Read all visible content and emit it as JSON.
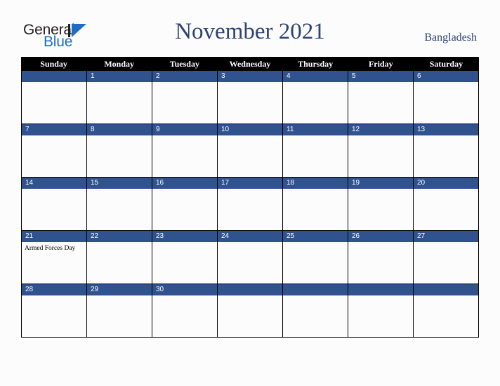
{
  "brand": {
    "name_part1": "General",
    "name_part2": "Blue",
    "mark": "triangle-logo-icon",
    "accent_color": "#1b6ec2",
    "text_color": "#231f20"
  },
  "header": {
    "title": "November 2021",
    "country": "Bangladesh",
    "title_color": "#2e4470"
  },
  "calendar": {
    "month": "November",
    "year": "2021",
    "header_bg": "#000000",
    "date_band_color": "#30538f",
    "cell_bg": "#fcfcfd",
    "weekdays": [
      "Sunday",
      "Monday",
      "Tuesday",
      "Wednesday",
      "Thursday",
      "Friday",
      "Saturday"
    ],
    "weeks": [
      [
        {
          "day": "",
          "event": ""
        },
        {
          "day": "1",
          "event": ""
        },
        {
          "day": "2",
          "event": ""
        },
        {
          "day": "3",
          "event": ""
        },
        {
          "day": "4",
          "event": ""
        },
        {
          "day": "5",
          "event": ""
        },
        {
          "day": "6",
          "event": ""
        }
      ],
      [
        {
          "day": "7",
          "event": ""
        },
        {
          "day": "8",
          "event": ""
        },
        {
          "day": "9",
          "event": ""
        },
        {
          "day": "10",
          "event": ""
        },
        {
          "day": "11",
          "event": ""
        },
        {
          "day": "12",
          "event": ""
        },
        {
          "day": "13",
          "event": ""
        }
      ],
      [
        {
          "day": "14",
          "event": ""
        },
        {
          "day": "15",
          "event": ""
        },
        {
          "day": "16",
          "event": ""
        },
        {
          "day": "17",
          "event": ""
        },
        {
          "day": "18",
          "event": ""
        },
        {
          "day": "19",
          "event": ""
        },
        {
          "day": "20",
          "event": ""
        }
      ],
      [
        {
          "day": "21",
          "event": "Armed Forces Day"
        },
        {
          "day": "22",
          "event": ""
        },
        {
          "day": "23",
          "event": ""
        },
        {
          "day": "24",
          "event": ""
        },
        {
          "day": "25",
          "event": ""
        },
        {
          "day": "26",
          "event": ""
        },
        {
          "day": "27",
          "event": ""
        }
      ],
      [
        {
          "day": "28",
          "event": ""
        },
        {
          "day": "29",
          "event": ""
        },
        {
          "day": "30",
          "event": ""
        },
        {
          "day": "",
          "event": ""
        },
        {
          "day": "",
          "event": ""
        },
        {
          "day": "",
          "event": ""
        },
        {
          "day": "",
          "event": ""
        }
      ]
    ]
  }
}
